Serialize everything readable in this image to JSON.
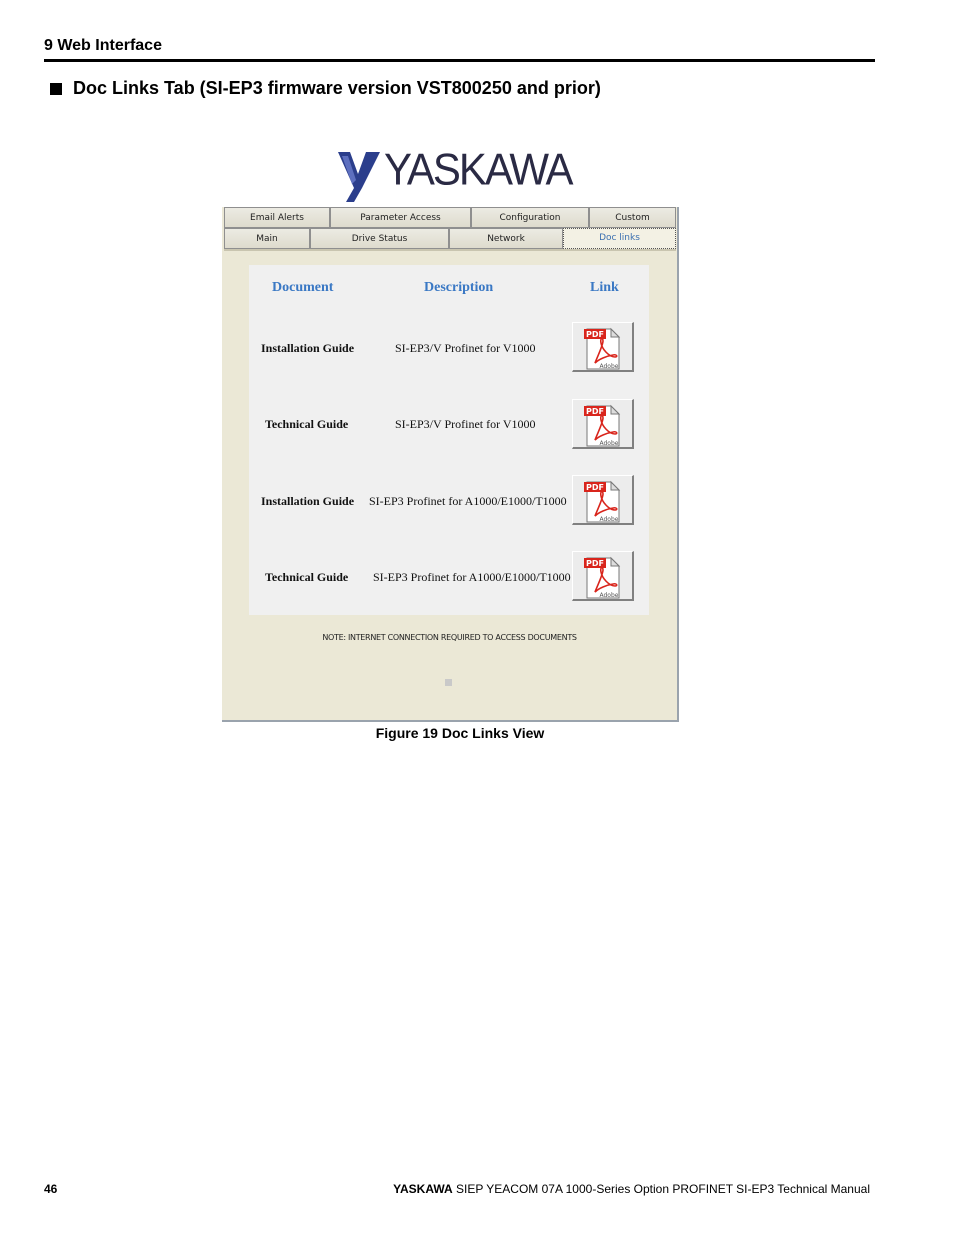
{
  "header": {
    "section": "9  Web Interface",
    "subsection": "Doc Links Tab (SI-EP3 firmware version VST800250 and prior)"
  },
  "logo": {
    "text": "YASKAWA"
  },
  "tabs": {
    "row1": [
      "Email Alerts",
      "Parameter Access",
      "Configuration",
      "Custom"
    ],
    "row2": [
      "Main",
      "Drive Status",
      "Network",
      "Doc links"
    ],
    "active": "Doc links"
  },
  "table": {
    "headers": {
      "document": "Document",
      "description": "Description",
      "link": "Link"
    },
    "rows": [
      {
        "document": "Installation Guide",
        "description": "SI-EP3/V Profinet for V1000",
        "link_icon": "pdf-icon"
      },
      {
        "document": "Technical Guide",
        "description": "SI-EP3/V Profinet for V1000",
        "link_icon": "pdf-icon"
      },
      {
        "document": "Installation Guide",
        "description": "SI-EP3 Profinet for A1000/E1000/T1000",
        "link_icon": "pdf-icon"
      },
      {
        "document": "Technical Guide",
        "description": "SI-EP3 Profinet for A1000/E1000/T1000",
        "link_icon": "pdf-icon"
      }
    ]
  },
  "pdf_icon": {
    "badge": "PDF",
    "label": "Adobe"
  },
  "note": "NOTE: INTERNET CONNECTION REQUIRED TO ACCESS DOCUMENTS",
  "caption": "Figure 19  Doc Links View",
  "footer": {
    "page_number": "46",
    "brand": "YASKAWA",
    "title": " SIEP YEACOM 07A 1000-Series Option PROFINET SI-EP3 Technical Manual"
  },
  "colors": {
    "frame_bg": "#ebe8d6",
    "panel_bg": "#f0f0f0",
    "header_blue": "#3a78c4",
    "pdf_red": "#d9251c"
  }
}
